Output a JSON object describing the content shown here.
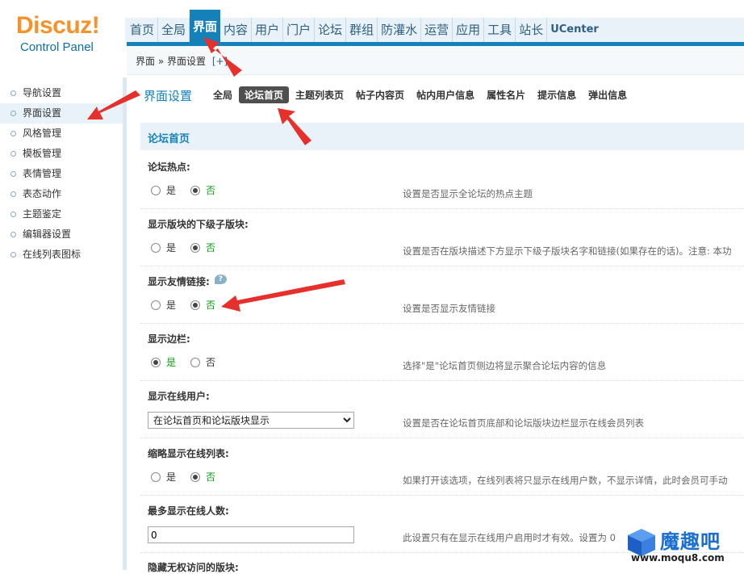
{
  "logo": {
    "brand": "Discuz!",
    "subtitle": "Control Panel"
  },
  "topnav": {
    "tabs": [
      "首页",
      "全局",
      "界面",
      "内容",
      "用户",
      "门户",
      "论坛",
      "群组",
      "防灌水",
      "运营",
      "应用",
      "工具",
      "站长",
      "UCenter"
    ],
    "active": "界面"
  },
  "breadcrumb": {
    "path": "界面 » 界面设置",
    "add": "[+]"
  },
  "sidebar": {
    "items": [
      "导航设置",
      "界面设置",
      "风格管理",
      "模板管理",
      "表情管理",
      "表态动作",
      "主题鉴定",
      "编辑器设置",
      "在线列表图标"
    ],
    "active": "界面设置"
  },
  "main": {
    "title": "界面设置",
    "subtabs": [
      "全局",
      "论坛首页",
      "主题列表页",
      "帖子内容页",
      "帖内用户信息",
      "属性名片",
      "提示信息",
      "弹出信息"
    ],
    "active_subtab": "论坛首页",
    "section": "论坛首页",
    "yes": "是",
    "no": "否",
    "help_glyph": "?",
    "rows": [
      {
        "label": "论坛热点:",
        "value": "否",
        "desc": "设置是否显示全论坛的热点主题"
      },
      {
        "label": "显示版块的下级子版块:",
        "value": "否",
        "desc": "设置是否在版块描述下方显示下级子版块名字和链接(如果存在的话)。注意: 本功"
      },
      {
        "label": "显示友情链接:",
        "value": "否",
        "desc": "设置是否显示友情链接"
      },
      {
        "label": "显示边栏:",
        "value": "是",
        "desc": "选择\"是\"论坛首页侧边将显示聚合论坛内容的信息"
      },
      {
        "label": "显示在线用户:",
        "select_value": "在论坛首页和论坛版块显示",
        "desc": "设置是否在论坛首页底部和论坛版块边栏显示在线会员列表"
      },
      {
        "label": "缩略显示在线列表:",
        "value": "否",
        "desc": "如果打开该选项，在线列表将只显示在线用户数，不显示详情，此时会员可手动"
      },
      {
        "label": "最多显示在线人数:",
        "input_value": "0",
        "desc": "此设置只有在显示在线用户启用时才有效。设置为 0"
      }
    ],
    "next_label": "隐藏无权访问的版块:"
  },
  "watermark": {
    "name": "魔趣吧",
    "url": "www.moqu8.com"
  },
  "colors": {
    "accent": "#1481b8",
    "logo_orange": "#f5922a",
    "selected_green": "#0a9c12",
    "annotation_red": "#e5302b"
  }
}
